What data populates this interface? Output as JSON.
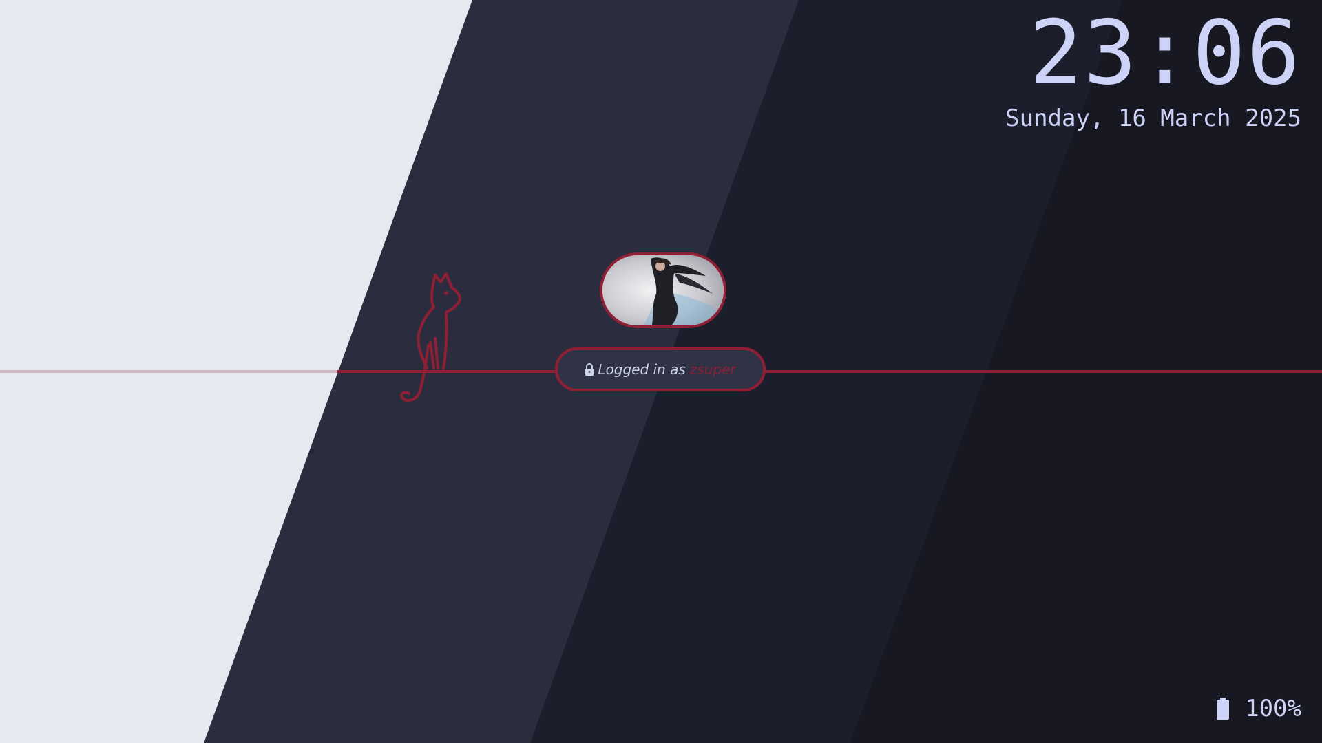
{
  "clock": {
    "time": "23:06",
    "date": "Sunday, 16 March 2025"
  },
  "login": {
    "prefix": "Logged in as",
    "username": "zsuper"
  },
  "battery": {
    "level": "100%",
    "icon": "battery-full-icon"
  },
  "icons": {
    "lock": "lock-icon",
    "cat": "cat-outline-icon"
  },
  "colors": {
    "accent": "#8e1f35",
    "text": "#cdd3f7",
    "panel_light": "#e6e9f0",
    "panel_mid": "#2b2d3e",
    "panel_dark": "#1d1e2b",
    "panel_darkest": "#171822"
  }
}
